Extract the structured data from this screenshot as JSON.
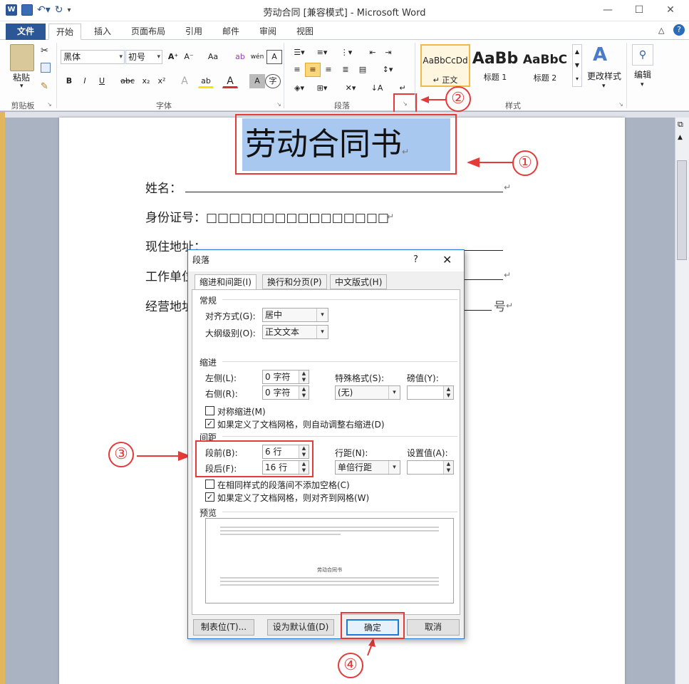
{
  "window": {
    "title": "劳动合同 [兼容模式] - Microsoft Word"
  },
  "tabs": [
    "文件",
    "开始",
    "插入",
    "页面布局",
    "引用",
    "邮件",
    "审阅",
    "视图"
  ],
  "ribbon": {
    "clipboard": {
      "label": "剪贴板",
      "paste": "粘贴"
    },
    "font": {
      "label": "字体",
      "name": "黑体",
      "size": "初号",
      "bold": "B",
      "italic": "I",
      "underline": "U",
      "strike": "abc",
      "sub": "x₂",
      "sup": "x²",
      "aa": "Aa"
    },
    "paragraph": {
      "label": "段落"
    },
    "styles": {
      "label": "样式",
      "items": [
        {
          "preview": "AaBbCcDd",
          "name": "↵ 正文"
        },
        {
          "preview": "AaBb",
          "name": "标题 1"
        },
        {
          "preview": "AaBbC",
          "name": "标题 2"
        }
      ],
      "change": "更改样式"
    },
    "edit": {
      "label": "编辑"
    }
  },
  "document": {
    "title": "劳动合同书",
    "lines": [
      {
        "label": "姓名："
      },
      {
        "label": "身份证号：□□□□□□□□□□□□□□□□"
      },
      {
        "label": "现住地址："
      },
      {
        "label": "工作单位："
      },
      {
        "label": "经营地址：",
        "suffix": "号"
      }
    ]
  },
  "dialog": {
    "title": "段落",
    "help": "?",
    "tabs": [
      "缩进和间距(I)",
      "换行和分页(P)",
      "中文版式(H)"
    ],
    "general": {
      "section": "常规",
      "align_label": "对齐方式(G):",
      "align_value": "居中",
      "outline_label": "大纲级别(O):",
      "outline_value": "正文文本"
    },
    "indent": {
      "section": "缩进",
      "left_label": "左侧(L):",
      "left_value": "0 字符",
      "right_label": "右侧(R):",
      "right_value": "0 字符",
      "special_label": "特殊格式(S):",
      "special_value": "(无)",
      "by_label": "磅值(Y):",
      "by_value": "",
      "mirror": "对称缩进(M)",
      "auto_adjust": "如果定义了文档网格，则自动调整右缩进(D)"
    },
    "spacing": {
      "section": "间距",
      "before_label": "段前(B):",
      "before_value": "6 行",
      "after_label": "段后(F):",
      "after_value": "16 行",
      "line_label": "行距(N):",
      "line_value": "单倍行距",
      "at_label": "设置值(A):",
      "at_value": "",
      "no_space": "在相同样式的段落间不添加空格(C)",
      "snap_grid": "如果定义了文档网格，则对齐到网格(W)"
    },
    "preview": {
      "section": "预览",
      "sample": "劳动合同书"
    },
    "buttons": {
      "tabs": "制表位(T)...",
      "default": "设为默认值(D)",
      "ok": "确定",
      "cancel": "取消"
    }
  },
  "callouts": [
    "①",
    "②",
    "③",
    "④"
  ],
  "colors": {
    "accent": "#2b5797",
    "callout": "#e53a3a",
    "selection": "#a8c8ef"
  }
}
